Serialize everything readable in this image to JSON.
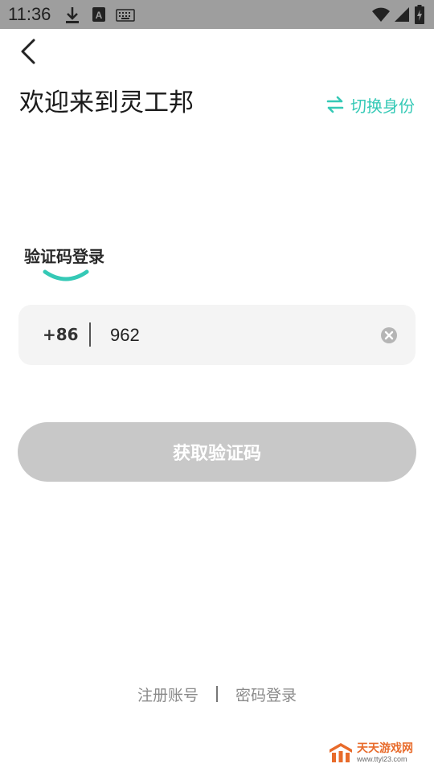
{
  "status_bar": {
    "time": "11:36",
    "icons": [
      "download-icon",
      "a-notification-icon",
      "keyboard-icon",
      "wifi-icon",
      "signal-icon",
      "battery-icon"
    ]
  },
  "header": {
    "back_icon": "chevron-left-icon",
    "title": "欢迎来到灵工邦",
    "switch_label": "切换身份",
    "switch_icon": "swap-arrows-icon"
  },
  "login": {
    "tab_label": "验证码登录",
    "country_code": "+86",
    "phone_value": "962",
    "phone_placeholder": "",
    "clear_icon": "clear-circle-icon",
    "get_code_label": "获取验证码"
  },
  "footer": {
    "register_label": "注册账号",
    "password_login_label": "密码登录"
  },
  "watermark": {
    "name": "天天游戏网",
    "url": "www.ttyl23.com"
  },
  "colors": {
    "accent": "#35c9b6",
    "status_bar": "#9e9e9e",
    "button_disabled": "#c8c8c8",
    "input_bg": "#f4f4f4"
  }
}
